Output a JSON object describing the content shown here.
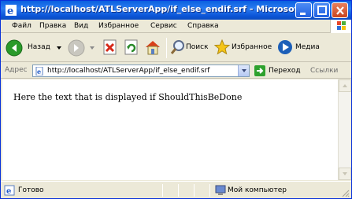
{
  "window": {
    "title": "http://localhost/ATLServerApp/if_else_endif.srf - Microsoft Inter..."
  },
  "menu": {
    "items": [
      "Файл",
      "Правка",
      "Вид",
      "Избранное",
      "Сервис",
      "Справка"
    ]
  },
  "toolbar": {
    "back_label": "Назад",
    "search_label": "Поиск",
    "favorites_label": "Избранное",
    "media_label": "Медиа"
  },
  "address": {
    "label": "Адрес",
    "url": "http://localhost/ATLServerApp/if_else_endif.srf",
    "go_label": "Переход",
    "links_label": "Ссылки"
  },
  "content": {
    "text": "Here the text that is displayed if ShouldThisBeDone"
  },
  "status": {
    "text": "Готово",
    "zone": "Мой компьютер"
  }
}
